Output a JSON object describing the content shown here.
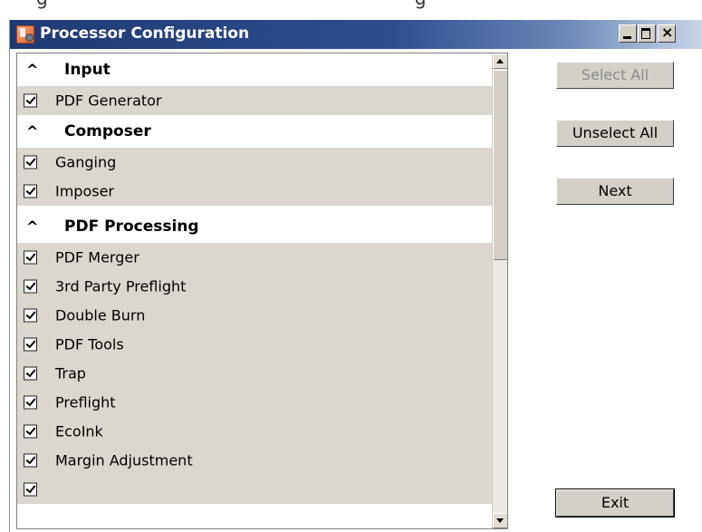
{
  "window": {
    "title": "Processor Configuration"
  },
  "list": {
    "groups": [
      {
        "label": "Input",
        "items": [
          {
            "label": "PDF Generator",
            "checked": true
          }
        ]
      },
      {
        "label": "Composer",
        "items": [
          {
            "label": "Ganging",
            "checked": true
          },
          {
            "label": "Imposer",
            "checked": true
          }
        ]
      },
      {
        "label": "PDF Processing",
        "items": [
          {
            "label": "PDF Merger",
            "checked": true
          },
          {
            "label": "3rd Party Preflight",
            "checked": true
          },
          {
            "label": "Double Burn",
            "checked": true
          },
          {
            "label": "PDF Tools",
            "checked": true
          },
          {
            "label": "Trap",
            "checked": true
          },
          {
            "label": "Preflight",
            "checked": true
          },
          {
            "label": "EcoInk",
            "checked": true
          },
          {
            "label": "Margin Adjustment",
            "checked": true
          }
        ]
      }
    ]
  },
  "buttons": {
    "select_all": "Select All",
    "unselect_all": "Unselect All",
    "next": "Next",
    "exit": "Exit"
  },
  "colors": {
    "titlebar": "#2d4d8e",
    "item_row": "#dbd7cf",
    "button_face": "#d4d0c8"
  }
}
